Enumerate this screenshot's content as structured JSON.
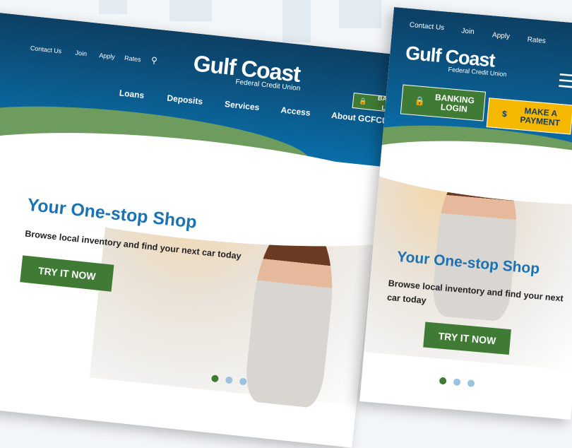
{
  "colors": {
    "brand_blue": "#0a6ea9",
    "header_dark": "#0d3f63",
    "green": "#3f7b34",
    "yellow": "#f5b800",
    "title_blue": "#1b73b3",
    "dot_active": "#3f7b34",
    "dot_inactive": "#9cc3dd"
  },
  "logo": {
    "main": "Gulf Coast",
    "sub": "Federal Credit Union"
  },
  "desktop": {
    "utility_nav": [
      "Contact Us",
      "Join",
      "Apply",
      "Rates"
    ],
    "search_icon": "search-icon",
    "main_nav": [
      "Loans",
      "Deposits",
      "Services",
      "Access",
      "About GCFCU"
    ],
    "banking_button": "BANKING LOGIN",
    "hero": {
      "title": "Your One-stop Shop",
      "subtitle": "Browse local inventory and find your next car today",
      "cta": "TRY IT NOW"
    },
    "carousel": {
      "count": 3,
      "active": 1
    }
  },
  "mobile": {
    "utility_nav": [
      "Contact Us",
      "Join",
      "Apply",
      "Rates"
    ],
    "menu_icon": "hamburger-icon",
    "banking_button": "BANKING LOGIN",
    "payment_button": "MAKE A PAYMENT",
    "hero": {
      "title": "Your One-stop Shop",
      "subtitle": "Browse local inventory and find your next car today",
      "cta": "TRY IT NOW"
    },
    "carousel": {
      "count": 3,
      "active": 1
    }
  }
}
